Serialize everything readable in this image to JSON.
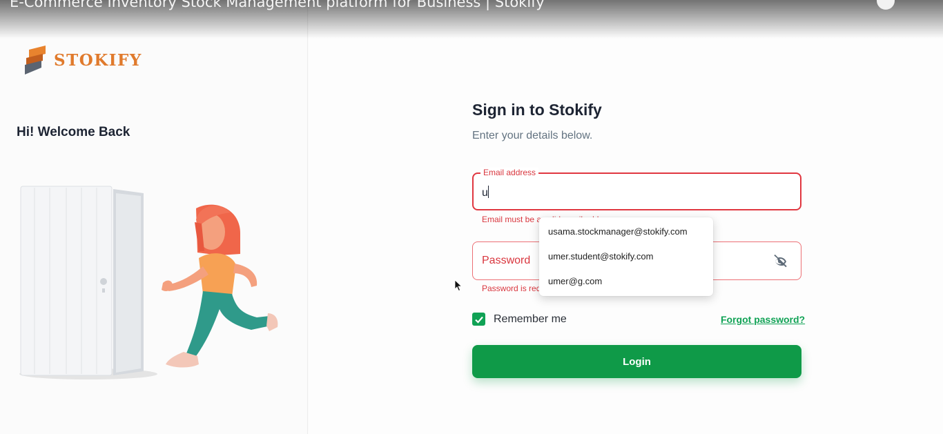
{
  "overlay": {
    "video_title": "E-Commerce Inventory Stock Management platform for Business | Stokify"
  },
  "brand": {
    "name": "STOKIFY",
    "accent_color": "#e07a2c"
  },
  "left": {
    "welcome": "Hi! Welcome Back",
    "illustration": "person-running-through-door"
  },
  "form": {
    "title": "Sign in to Stokify",
    "subtitle": "Enter your details below.",
    "email": {
      "label": "Email address",
      "value": "u",
      "helper": "Email must be a valid email address"
    },
    "password": {
      "placeholder": "Password",
      "helper": "Password is required",
      "toggle_icon": "eye-off-icon"
    },
    "autocomplete": [
      "usama.stockmanager@stokify.com",
      "umer.student@stokify.com",
      "umer@g.com"
    ],
    "remember_label": "Remember me",
    "remember_checked": true,
    "forgot_label": "Forgot password?",
    "login_label": "Login",
    "primary_color": "#0f9a48",
    "error_color": "#d9363e"
  }
}
